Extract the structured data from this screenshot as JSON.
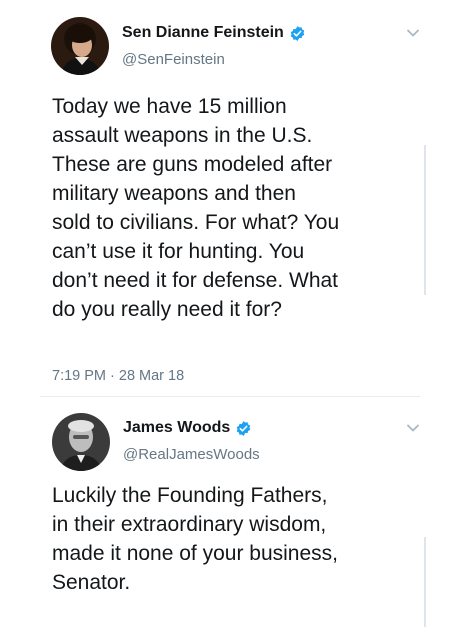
{
  "tweets": [
    {
      "display_name": "Sen Dianne Feinstein",
      "handle": "@SenFeinstein",
      "verified_icon": "verified-badge-icon",
      "body_lines": [
        "Today we have 15 million",
        "assault weapons in the U.S.",
        "These are guns modeled after",
        "military weapons and then",
        "sold to civilians. For what? You",
        "can’t use it for hunting. You",
        "don’t need it for defense. What",
        "do you really need it for?"
      ],
      "timestamp": "7:19 PM · 28 Mar 18"
    },
    {
      "display_name": "James Woods",
      "handle": "@RealJamesWoods",
      "verified_icon": "verified-badge-icon",
      "body_lines": [
        "Luckily the Founding Fathers,",
        "in their extraordinary wisdom,",
        "made it none of your business,",
        "Senator."
      ]
    }
  ],
  "colors": {
    "verified_blue": "#1da1f2",
    "secondary_text": "#657786",
    "primary_text": "#14171a",
    "divider": "#e6ecf0"
  }
}
